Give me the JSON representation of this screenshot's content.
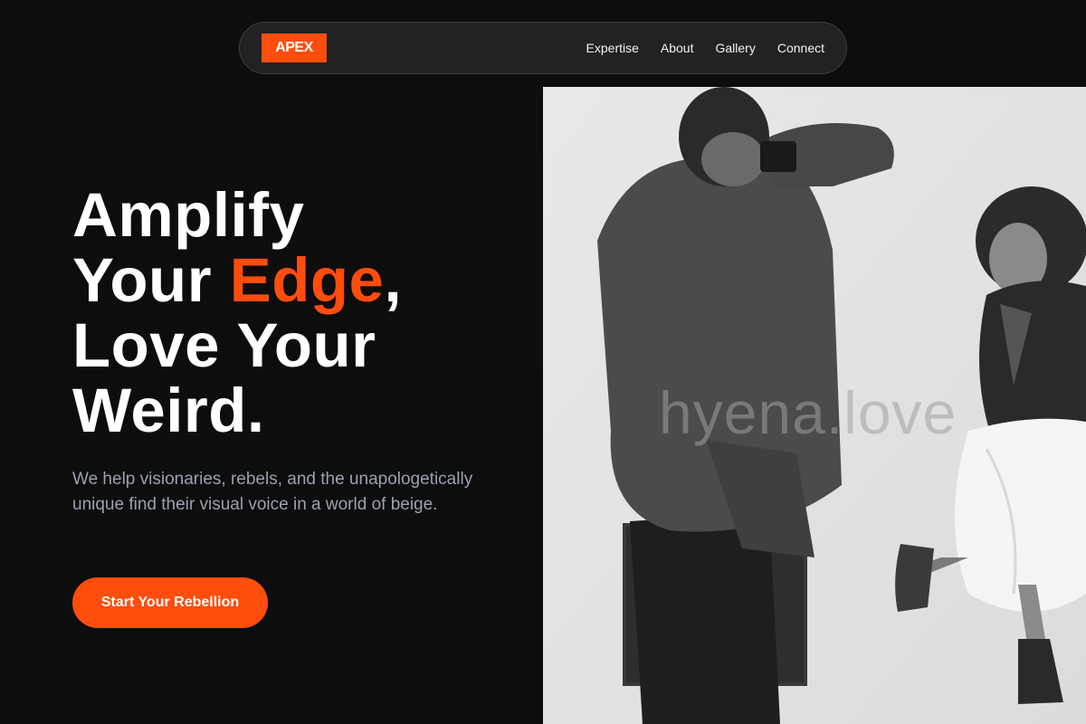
{
  "brand": {
    "logo": "APEX",
    "accent_color": "#ff4d0d"
  },
  "nav": {
    "links": [
      "Expertise",
      "About",
      "Gallery",
      "Connect"
    ]
  },
  "hero": {
    "headline_line1": "Amplify",
    "headline_line2_start": "Your ",
    "headline_line2_accent": "Edge",
    "headline_line2_end": ",",
    "headline_line3": "Love Your",
    "headline_line4": "Weird.",
    "subtitle": "We help visionaries, rebels, and the unapologetically unique find their visual voice in a world of beige.",
    "cta_label": "Start Your Rebellion"
  },
  "image": {
    "watermark": "hyena.love",
    "style": "black-and-white photo of photographer shooting a smiling woman in leather jacket"
  }
}
